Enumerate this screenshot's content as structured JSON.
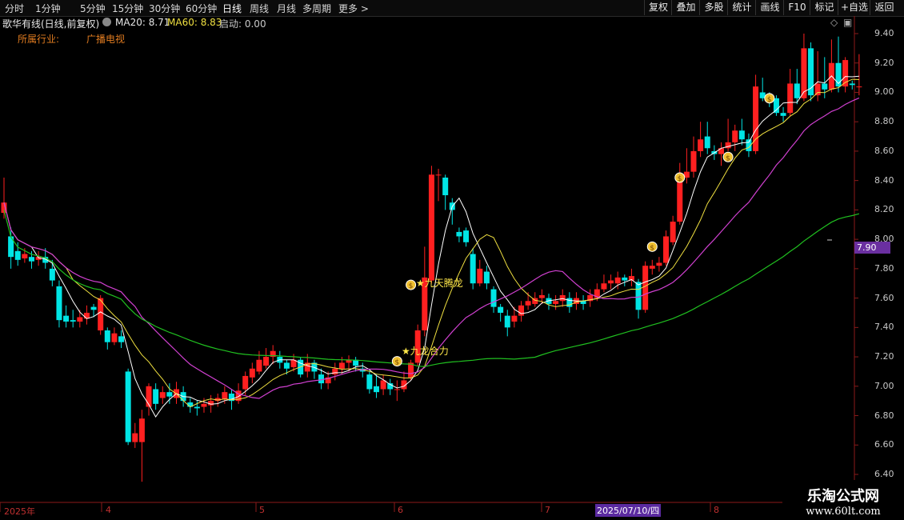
{
  "timeframes": [
    "分时",
    "1分钟",
    "5分钟",
    "15分钟",
    "30分钟",
    "60分钟",
    "日线",
    "周线",
    "月线",
    "多周期",
    "更多"
  ],
  "timeframe_active": "日线",
  "toolbar": [
    "复权",
    "叠加",
    "多股",
    "统计",
    "画线",
    "F10",
    "标记",
    "+自选",
    "返回"
  ],
  "stock_title": "歌华有线(日线,前复权)",
  "indicators": {
    "ma20_label": "MA20: 8.71",
    "ma60_label": "MA60: 8.83",
    "start_label": "启动: 0.00"
  },
  "industry": {
    "label": "所属行业:",
    "value": "广播电视"
  },
  "price_axis": [
    "9.40",
    "9.20",
    "9.00",
    "8.80",
    "8.60",
    "8.40",
    "8.20",
    "8.00",
    "7.80",
    "7.60",
    "7.40",
    "7.20",
    "7.00",
    "6.80",
    "6.60",
    "6.40"
  ],
  "current_price_tag": "7.90",
  "date_axis": [
    "2025年",
    "4",
    "5",
    "6",
    "7",
    "8"
  ],
  "date_highlight": "2025/07/10/四",
  "signals": [
    "★九龙合力",
    "★九天腾龙"
  ],
  "watermark": {
    "line1": "乐淘公式网",
    "line2": "www.60lt.com"
  },
  "colors": {
    "up": "#ff2020",
    "down": "#00e5e5",
    "ma_white": "#ffffff",
    "ma_yellow": "#f0e040",
    "ma_magenta": "#d040d0",
    "ma_green": "#20c020",
    "accent": "#6a2fa0"
  },
  "chart_data": {
    "type": "candlestick",
    "ylim": [
      6.4,
      9.45
    ],
    "candles": [
      [
        8.18,
        8.25,
        8.42,
        8.14
      ],
      [
        8.02,
        7.88,
        8.08,
        7.8
      ],
      [
        7.92,
        7.86,
        7.98,
        7.82
      ],
      [
        7.87,
        7.9,
        7.94,
        7.84
      ],
      [
        7.88,
        7.85,
        7.92,
        7.8
      ],
      [
        7.86,
        7.88,
        7.92,
        7.82
      ],
      [
        7.88,
        7.84,
        7.94,
        7.8
      ],
      [
        7.8,
        7.72,
        7.86,
        7.68
      ],
      [
        7.68,
        7.45,
        7.72,
        7.4
      ],
      [
        7.48,
        7.44,
        7.55,
        7.4
      ],
      [
        7.45,
        7.44,
        7.52,
        7.4
      ],
      [
        7.44,
        7.47,
        7.52,
        7.4
      ],
      [
        7.46,
        7.5,
        7.55,
        7.42
      ],
      [
        7.54,
        7.52,
        7.56,
        7.47
      ],
      [
        7.38,
        7.6,
        7.62,
        7.35
      ],
      [
        7.38,
        7.3,
        7.4,
        7.25
      ],
      [
        7.3,
        7.36,
        7.4,
        7.28
      ],
      [
        7.34,
        7.3,
        7.38,
        7.26
      ],
      [
        7.1,
        6.62,
        7.12,
        6.6
      ],
      [
        6.62,
        6.68,
        6.75,
        6.58
      ],
      [
        6.62,
        6.78,
        6.84,
        6.35
      ],
      [
        6.86,
        7.0,
        7.02,
        6.8
      ],
      [
        6.98,
        6.88,
        7.02,
        6.84
      ],
      [
        6.92,
        6.96,
        7.0,
        6.88
      ],
      [
        6.96,
        6.93,
        7.02,
        6.88
      ],
      [
        6.92,
        6.98,
        7.03,
        6.88
      ],
      [
        6.96,
        6.9,
        7.0,
        6.86
      ],
      [
        6.89,
        6.86,
        6.92,
        6.82
      ],
      [
        6.86,
        6.85,
        6.9,
        6.8
      ],
      [
        6.86,
        6.88,
        6.92,
        6.82
      ],
      [
        6.87,
        6.9,
        6.94,
        6.82
      ],
      [
        6.9,
        6.92,
        6.95,
        6.86
      ],
      [
        6.91,
        6.96,
        7.0,
        6.88
      ],
      [
        6.95,
        6.9,
        6.98,
        6.84
      ],
      [
        6.9,
        6.97,
        7.02,
        6.88
      ],
      [
        6.98,
        7.07,
        7.1,
        6.94
      ],
      [
        7.06,
        7.12,
        7.16,
        7.02
      ],
      [
        7.1,
        7.18,
        7.24,
        7.08
      ],
      [
        7.14,
        7.2,
        7.26,
        7.12
      ],
      [
        7.2,
        7.24,
        7.28,
        7.15
      ],
      [
        7.2,
        7.16,
        7.24,
        7.12
      ],
      [
        7.16,
        7.12,
        7.18,
        7.08
      ],
      [
        7.13,
        7.18,
        7.22,
        7.1
      ],
      [
        7.18,
        7.08,
        7.2,
        7.06
      ],
      [
        7.1,
        7.16,
        7.22,
        7.06
      ],
      [
        7.16,
        7.1,
        7.18,
        7.05
      ],
      [
        7.08,
        7.02,
        7.12,
        6.98
      ],
      [
        7.02,
        7.06,
        7.1,
        6.98
      ],
      [
        7.08,
        7.12,
        7.16,
        7.04
      ],
      [
        7.12,
        7.16,
        7.2,
        7.08
      ],
      [
        7.16,
        7.18,
        7.21,
        7.1
      ],
      [
        7.18,
        7.14,
        7.2,
        7.1
      ],
      [
        7.12,
        7.1,
        7.16,
        7.06
      ],
      [
        7.08,
        6.98,
        7.1,
        6.95
      ],
      [
        7.0,
        6.96,
        7.08,
        6.92
      ],
      [
        6.98,
        7.04,
        7.08,
        6.94
      ],
      [
        7.02,
        6.98,
        7.05,
        6.94
      ],
      [
        6.98,
        6.98,
        7.04,
        6.9
      ],
      [
        6.98,
        7.04,
        7.1,
        6.96
      ],
      [
        7.06,
        7.16,
        7.18,
        7.04
      ],
      [
        7.16,
        7.38,
        7.42,
        7.14
      ],
      [
        7.38,
        7.74,
        7.95,
        7.34
      ],
      [
        7.72,
        8.44,
        8.5,
        7.7
      ],
      [
        8.44,
        8.44,
        8.48,
        8.26
      ],
      [
        8.42,
        8.3,
        8.44,
        8.2
      ],
      [
        8.25,
        8.2,
        8.28,
        8.1
      ],
      [
        8.05,
        8.02,
        8.08,
        7.98
      ],
      [
        8.06,
        7.98,
        8.08,
        7.95
      ],
      [
        7.9,
        7.7,
        7.94,
        7.66
      ],
      [
        7.7,
        7.8,
        7.86,
        7.68
      ],
      [
        7.78,
        7.7,
        7.82,
        7.66
      ],
      [
        7.66,
        7.54,
        7.68,
        7.5
      ],
      [
        7.54,
        7.5,
        7.56,
        7.44
      ],
      [
        7.48,
        7.4,
        7.52,
        7.34
      ],
      [
        7.44,
        7.48,
        7.54,
        7.4
      ],
      [
        7.48,
        7.55,
        7.58,
        7.44
      ],
      [
        7.55,
        7.58,
        7.64,
        7.52
      ],
      [
        7.56,
        7.6,
        7.64,
        7.54
      ],
      [
        7.6,
        7.62,
        7.66,
        7.56
      ],
      [
        7.6,
        7.56,
        7.63,
        7.52
      ],
      [
        7.56,
        7.58,
        7.62,
        7.52
      ],
      [
        7.58,
        7.62,
        7.66,
        7.54
      ],
      [
        7.6,
        7.54,
        7.64,
        7.5
      ],
      [
        7.56,
        7.6,
        7.64,
        7.52
      ],
      [
        7.58,
        7.56,
        7.62,
        7.52
      ],
      [
        7.58,
        7.62,
        7.66,
        7.54
      ],
      [
        7.6,
        7.66,
        7.7,
        7.58
      ],
      [
        7.66,
        7.7,
        7.76,
        7.64
      ],
      [
        7.7,
        7.72,
        7.76,
        7.66
      ],
      [
        7.7,
        7.74,
        7.78,
        7.66
      ],
      [
        7.74,
        7.72,
        7.76,
        7.68
      ],
      [
        7.72,
        7.75,
        7.8,
        7.68
      ],
      [
        7.71,
        7.52,
        7.73,
        7.46
      ],
      [
        7.52,
        7.82,
        7.85,
        7.5
      ],
      [
        7.8,
        7.82,
        7.86,
        7.76
      ],
      [
        7.82,
        7.84,
        7.88,
        7.78
      ],
      [
        7.84,
        8.02,
        8.06,
        7.82
      ],
      [
        7.98,
        8.12,
        8.16,
        7.96
      ],
      [
        8.12,
        8.44,
        8.52,
        8.1
      ],
      [
        8.42,
        8.46,
        8.62,
        8.38
      ],
      [
        8.46,
        8.6,
        8.7,
        8.42
      ],
      [
        8.6,
        8.68,
        8.8,
        8.56
      ],
      [
        8.7,
        8.62,
        8.8,
        8.58
      ],
      [
        8.6,
        8.58,
        8.64,
        8.54
      ],
      [
        8.58,
        8.62,
        8.66,
        8.5
      ],
      [
        8.62,
        8.66,
        8.82,
        8.6
      ],
      [
        8.66,
        8.74,
        8.78,
        8.6
      ],
      [
        8.74,
        8.68,
        8.82,
        8.64
      ],
      [
        8.68,
        8.6,
        8.72,
        8.56
      ],
      [
        8.6,
        9.04,
        9.12,
        8.58
      ],
      [
        9.0,
        8.96,
        9.1,
        8.94
      ],
      [
        8.98,
        8.94,
        9.0,
        8.9
      ],
      [
        8.96,
        8.86,
        8.98,
        8.84
      ],
      [
        8.86,
        8.84,
        8.9,
        8.8
      ],
      [
        8.86,
        9.06,
        9.16,
        8.84
      ],
      [
        9.06,
        8.96,
        9.16,
        8.92
      ],
      [
        8.96,
        9.3,
        9.4,
        8.94
      ],
      [
        9.3,
        8.98,
        9.34,
        8.94
      ],
      [
        8.98,
        9.06,
        9.28,
        8.94
      ],
      [
        9.06,
        9.02,
        9.24,
        8.96
      ],
      [
        9.02,
        9.2,
        9.36,
        9.0
      ],
      [
        9.2,
        9.04,
        9.38,
        9.0
      ],
      [
        9.04,
        9.22,
        9.24,
        9.0
      ],
      [
        9.06,
        9.05,
        9.08,
        9.02
      ],
      [
        9.04,
        9.04,
        9.26,
        8.98
      ]
    ]
  }
}
